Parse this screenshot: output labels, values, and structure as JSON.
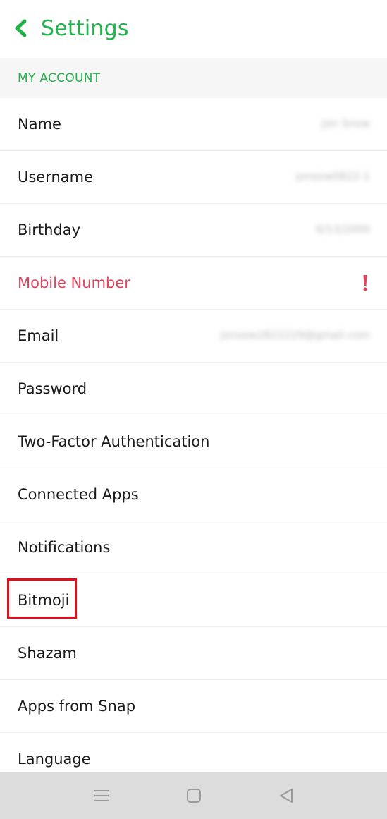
{
  "header": {
    "title": "Settings",
    "back_icon": "chevron-left-icon",
    "accent": "#22b24c"
  },
  "section": {
    "label": "MY ACCOUNT"
  },
  "rows": [
    {
      "label": "Name",
      "value": "Jon Snow"
    },
    {
      "label": "Username",
      "value": "jonsow0822-1"
    },
    {
      "label": "Birthday",
      "value": "6/13/2000"
    },
    {
      "label": "Mobile Number",
      "value": "",
      "status_color": "#e0455d",
      "status_icon": "exclamation-icon"
    },
    {
      "label": "Email",
      "value": "jonsow2822229@gmail.com"
    },
    {
      "label": "Password",
      "value": ""
    },
    {
      "label": "Two-Factor Authentication",
      "value": ""
    },
    {
      "label": "Connected Apps",
      "value": ""
    },
    {
      "label": "Notifications",
      "value": ""
    },
    {
      "label": "Bitmoji",
      "value": "",
      "highlighted": true,
      "highlight_color": "#e0101a"
    },
    {
      "label": "Shazam",
      "value": ""
    },
    {
      "label": "Apps from Snap",
      "value": ""
    },
    {
      "label": "Language",
      "value": ""
    }
  ],
  "navbar": {
    "icons": [
      "menu-icon",
      "home-square-icon",
      "back-triangle-icon"
    ]
  }
}
